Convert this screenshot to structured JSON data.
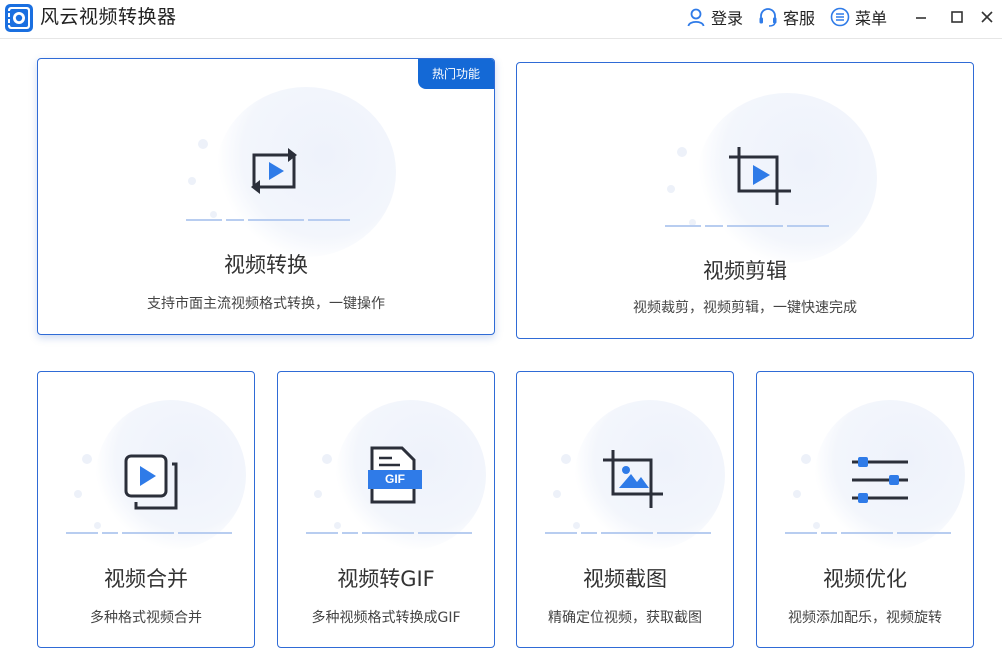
{
  "app": {
    "title": "风云视频转换器"
  },
  "toolbar": {
    "login": "登录",
    "service": "客服",
    "menu": "菜单"
  },
  "cards": {
    "convert": {
      "title": "视频转换",
      "desc": "支持市面主流视频格式转换，一键操作",
      "badge": "热门功能"
    },
    "edit": {
      "title": "视频剪辑",
      "desc": "视频裁剪，视频剪辑，一键快速完成"
    },
    "merge": {
      "title": "视频合并",
      "desc": "多种格式视频合并"
    },
    "gif": {
      "title": "视频转GIF",
      "desc": "多种视频格式转换成GIF",
      "icon_label": "GIF"
    },
    "capture": {
      "title": "视频截图",
      "desc": "精确定位视频，获取截图"
    },
    "optimize": {
      "title": "视频优化",
      "desc": "视频添加配乐，视频旋转"
    }
  },
  "colors": {
    "accent": "#1469d6",
    "border": "#2f6bd6",
    "icon_dark": "#2b2f3a",
    "icon_blue": "#2f7be8"
  }
}
